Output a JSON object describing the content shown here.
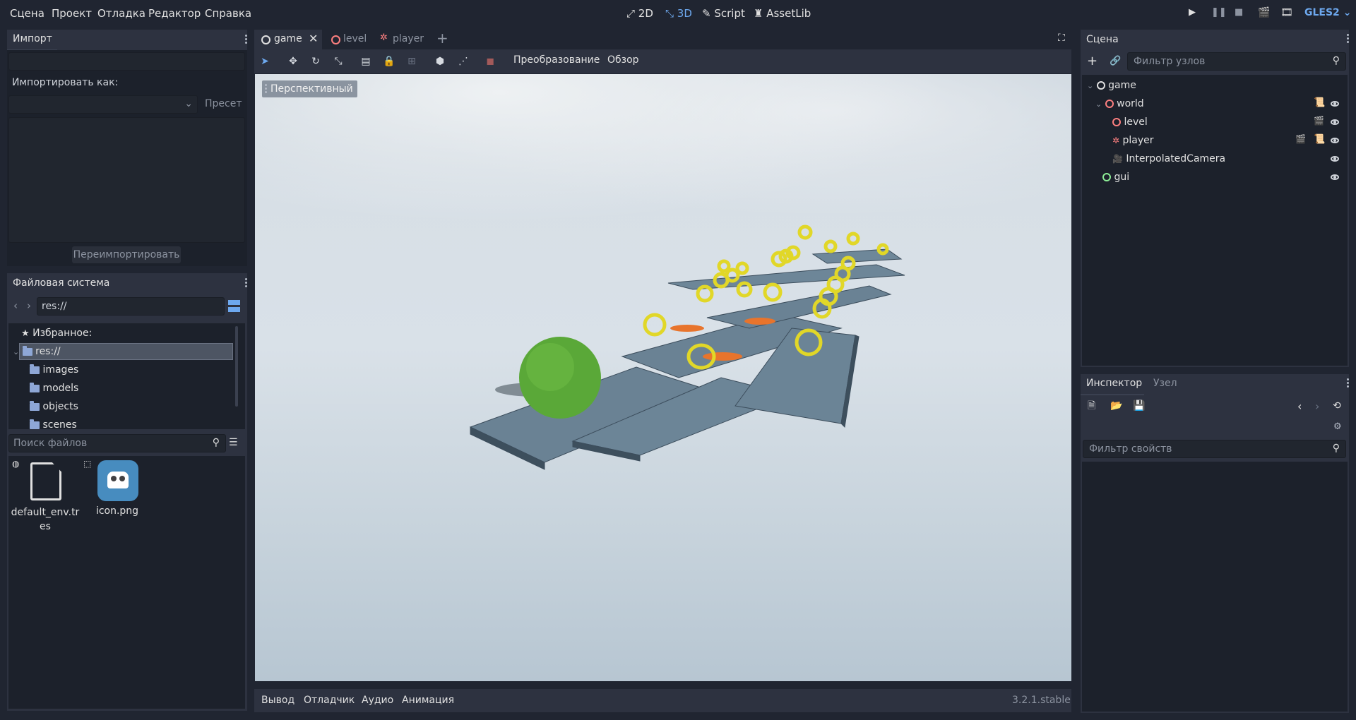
{
  "menu": {
    "items": [
      "Сцена",
      "Проект",
      "Отладка",
      "Редактор",
      "Справка"
    ],
    "workspaces": [
      {
        "icon": "2d-icon",
        "label": "2D"
      },
      {
        "icon": "3d-icon",
        "label": "3D"
      },
      {
        "icon": "script-icon",
        "label": "Script"
      },
      {
        "icon": "assetlib-icon",
        "label": "AssetLib"
      }
    ],
    "renderer": "GLES2",
    "accent": "#6da8ee"
  },
  "import_dock": {
    "tab": "Импорт",
    "import_as_label": "Импортировать как:",
    "preset_label": "Пресет",
    "reimport_label": "Переимпортировать"
  },
  "filesystem": {
    "tab": "Файловая система",
    "path": "res://",
    "favorites_label": "Избранное:",
    "root_label": "res://",
    "folders": [
      "images",
      "models",
      "objects",
      "scenes"
    ],
    "search_placeholder": "Поиск файлов",
    "files": [
      {
        "name": "default_env.tres",
        "icon": "file-icon"
      },
      {
        "name": "icon.png",
        "icon": "godot-icon"
      }
    ]
  },
  "editor_tabs": {
    "tabs": [
      {
        "label": "game",
        "active": true
      },
      {
        "label": "level",
        "active": false
      },
      {
        "label": "player",
        "active": false
      }
    ]
  },
  "viewport_toolbar": {
    "transform_menu": "Преобразование",
    "view_menu": "Обзор",
    "perspective_label": "Перспективный"
  },
  "bottom_panel": {
    "tabs": [
      "Вывод",
      "Отладчик",
      "Аудио",
      "Анимация"
    ],
    "version": "3.2.1.stable"
  },
  "scene_dock": {
    "tab": "Сцена",
    "filter_placeholder": "Фильтр узлов",
    "nodes": [
      {
        "name": "game",
        "color": "#e0e0e0"
      },
      {
        "name": "world",
        "color": "#fc7f7f"
      },
      {
        "name": "level",
        "color": "#fc7f7f"
      },
      {
        "name": "player",
        "color": "#fc7f7f"
      },
      {
        "name": "InterpolatedCamera",
        "color": "#fc7f7f"
      },
      {
        "name": "gui",
        "color": "#8eef97"
      }
    ]
  },
  "inspector_dock": {
    "tabs": [
      "Инспектор",
      "Узел"
    ],
    "filter_placeholder": "Фильтр свойств"
  }
}
